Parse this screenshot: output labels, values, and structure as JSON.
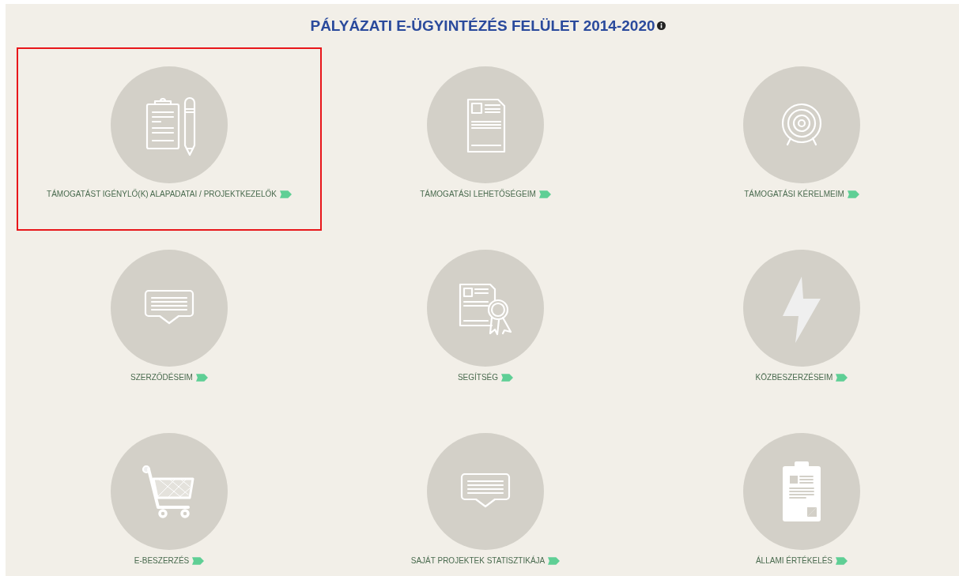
{
  "title": "PÁLYÁZATI E-ÜGYINTÉZÉS FELÜLET 2014-2020",
  "tiles": [
    {
      "label": "TÁMOGATÁST IGÉNYLŐ(K) ALAPADATAI / PROJEKTKEZELŐK",
      "kind": "clipboard-pencil",
      "highlighted": true
    },
    {
      "label": "TÁMOGATÁSI LEHETŐSÉGEIM",
      "kind": "document",
      "highlighted": false
    },
    {
      "label": "TÁMOGATÁSI KÉRELMEIM",
      "kind": "target",
      "highlighted": false
    },
    {
      "label": "SZERZŐDÉSEIM",
      "kind": "speech",
      "highlighted": false
    },
    {
      "label": "SEGÍTSÉG",
      "kind": "certificate",
      "highlighted": false
    },
    {
      "label": "KÖZBESZERZÉSEIM",
      "kind": "bolt",
      "highlighted": false
    },
    {
      "label": "E-BESZERZÉS",
      "kind": "cart",
      "highlighted": false
    },
    {
      "label": "SAJÁT PROJEKTEK STATISZTIKÁJA",
      "kind": "speech",
      "highlighted": false
    },
    {
      "label": "ÁLLAMI ÉRTÉKELÉS",
      "kind": "clipboard",
      "highlighted": false
    }
  ]
}
